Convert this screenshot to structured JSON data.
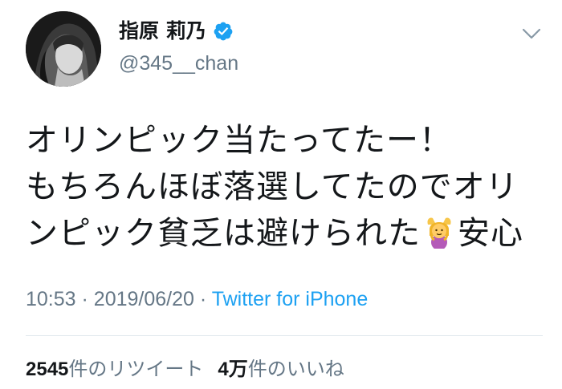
{
  "author": {
    "display_name": "指原 莉乃",
    "handle": "@345__chan",
    "verified": true
  },
  "tweet": {
    "lines": [
      "オリンピック当たってたー！",
      "もちろんほぼ落選してたのでオリ",
      "ンピック貧乏は避けられた",
      "安心"
    ],
    "emoji": "woman-gesturing-ok"
  },
  "meta": {
    "time": "10:53",
    "sep1": "·",
    "date": "2019/06/20",
    "sep2": "·",
    "source": "Twitter for iPhone"
  },
  "stats": {
    "retweets_count": "2545",
    "retweets_label": "件のリツイート",
    "likes_count": "4万",
    "likes_label": "件のいいね"
  },
  "colors": {
    "text": "#14171a",
    "secondary": "#657786",
    "link": "#1da1f2",
    "divider": "#e1e8ed"
  }
}
